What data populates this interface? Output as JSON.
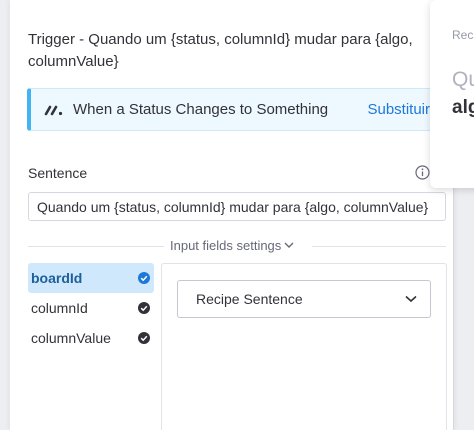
{
  "trigger": {
    "title": "Trigger - Quando um {status, columnId} mudar para {algo, columnValue}",
    "status_text": "When a Status Changes to Something",
    "replace_label": "Substituir",
    "logo_icon": "monday-logo-icon"
  },
  "sentence": {
    "label": "Sentence",
    "value": "Quando um {status, columnId} mudar para {algo, columnValue}",
    "info_icon": "info-icon"
  },
  "input_settings": {
    "label": "Input fields settings",
    "fields": [
      {
        "name": "boardId",
        "active": true
      },
      {
        "name": "columnId",
        "active": false
      },
      {
        "name": "columnValue",
        "active": false
      }
    ],
    "select_label": "Recipe Sentence"
  },
  "right_card": {
    "label": "Rec",
    "placeholder": "Qu",
    "value": "alg"
  },
  "colors": {
    "accent": "#42b4f2",
    "link": "#1d78d8",
    "active_bg": "#cfe8fb",
    "text": "#323338"
  }
}
